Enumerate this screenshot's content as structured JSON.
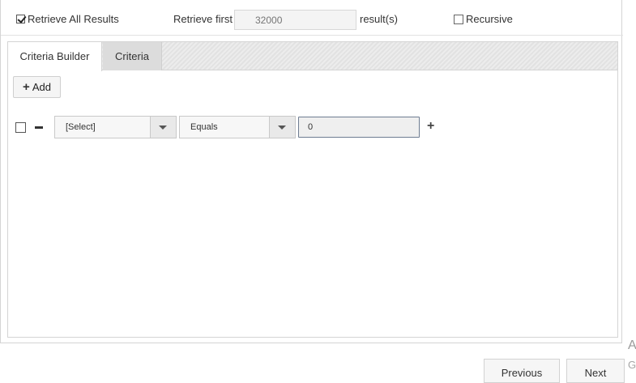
{
  "options": {
    "retrieve_all_label": "Retrieve All Results",
    "retrieve_all_checked": true,
    "retrieve_first_label": "Retrieve first",
    "retrieve_first_placeholder": "32000",
    "results_suffix": "result(s)",
    "recursive_label": "Recursive",
    "recursive_checked": false
  },
  "tabs": [
    {
      "label": "Criteria Builder",
      "active": true
    },
    {
      "label": "Criteria",
      "active": false
    }
  ],
  "builder": {
    "add_label": "Add",
    "row": {
      "checked": false,
      "field_value": "[Select]",
      "operator_value": "Equals",
      "input_value": "0"
    }
  },
  "side_text": {
    "line1": "A",
    "line2": "G"
  },
  "footer": {
    "previous_label": "Previous",
    "next_label": "Next"
  }
}
